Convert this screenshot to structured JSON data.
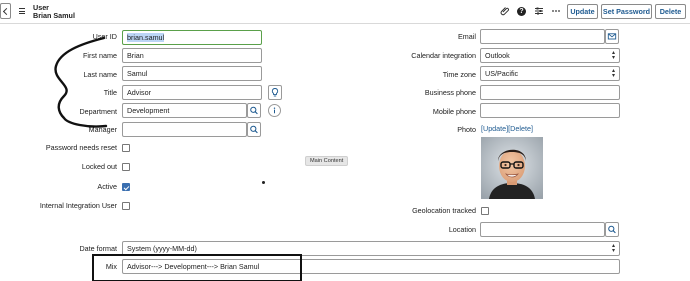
{
  "header": {
    "record_type": "User",
    "record_name": "Brian Samul",
    "icons": [
      "paperclip-icon",
      "help-icon",
      "settings-sliders-icon",
      "more-options-icon"
    ],
    "help_glyph": "?",
    "update_label": "Update",
    "set_password_label": "Set Password",
    "delete_label": "Delete"
  },
  "left": {
    "user_id": {
      "label": "User ID",
      "value": "brian.samul"
    },
    "first_name": {
      "label": "First name",
      "value": "Brian"
    },
    "last_name": {
      "label": "Last name",
      "value": "Samul"
    },
    "title": {
      "label": "Title",
      "value": "Advisor"
    },
    "department": {
      "label": "Department",
      "value": "Development"
    },
    "manager": {
      "label": "Manager",
      "value": ""
    },
    "password_needs_reset": {
      "label": "Password needs reset",
      "checked": false
    },
    "locked_out": {
      "label": "Locked out",
      "checked": false
    },
    "active": {
      "label": "Active",
      "checked": true
    },
    "internal_integration_user": {
      "label": "Internal Integration User",
      "checked": false
    }
  },
  "right": {
    "email": {
      "label": "Email",
      "value": ""
    },
    "calendar_integration": {
      "label": "Calendar integration",
      "value": "Outlook"
    },
    "time_zone": {
      "label": "Time zone",
      "value": "US/Pacific"
    },
    "business_phone": {
      "label": "Business phone",
      "value": ""
    },
    "mobile_phone": {
      "label": "Mobile phone",
      "value": ""
    },
    "photo": {
      "label": "Photo",
      "update_link": "[Update]",
      "delete_link": "[Delete]"
    },
    "geolocation_tracked": {
      "label": "Geolocation tracked",
      "checked": false
    },
    "location": {
      "label": "Location",
      "value": ""
    }
  },
  "date_format": {
    "label": "Date format",
    "value": "System (yyyy-MM-dd)"
  },
  "mix": {
    "label": "Mix",
    "value": "Advisor---> Development---> Brian Samul"
  },
  "tooltip": "Main Content",
  "colors": {
    "accent": "#1f5b91",
    "focus": "#5aa04a",
    "checkbox": "#3a6fb0"
  }
}
